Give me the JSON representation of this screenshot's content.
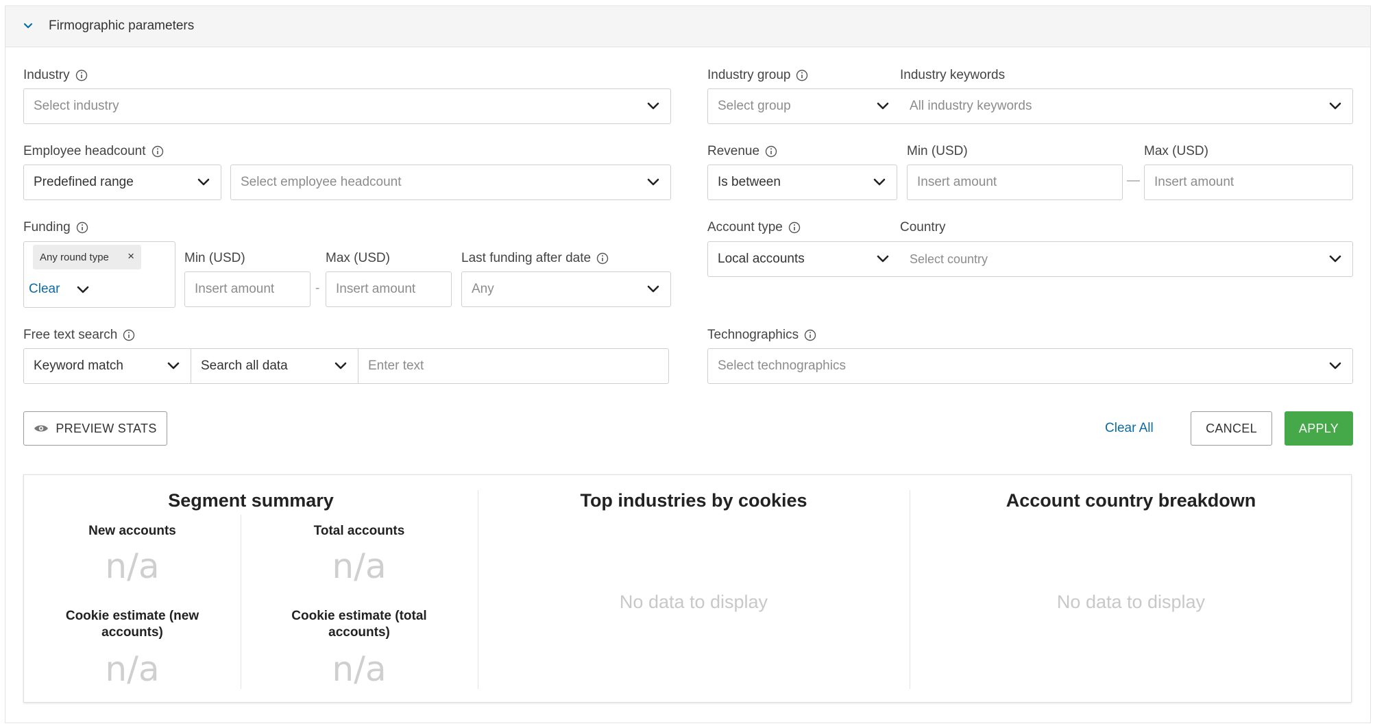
{
  "section": {
    "title": "Firmographic parameters"
  },
  "industry": {
    "label": "Industry",
    "placeholder": "Select industry"
  },
  "industry_group": {
    "label": "Industry group",
    "placeholder": "Select group"
  },
  "industry_keywords": {
    "label": "Industry keywords",
    "placeholder": "All industry keywords"
  },
  "employee_headcount": {
    "label": "Employee headcount",
    "mode_value": "Predefined range",
    "placeholder": "Select employee headcount"
  },
  "revenue": {
    "label": "Revenue",
    "operator_value": "Is between",
    "min_label": "Min (USD)",
    "max_label": "Max (USD)",
    "min_placeholder": "Insert amount",
    "max_placeholder": "Insert amount",
    "separator": "—"
  },
  "funding": {
    "label": "Funding",
    "chip": "Any round type",
    "chip_remove": "×",
    "clear_link": "Clear",
    "min_label": "Min (USD)",
    "max_label": "Max (USD)",
    "min_placeholder": "Insert amount",
    "max_placeholder": "Insert amount",
    "separator": "-",
    "last_funding_label": "Last funding after date",
    "last_funding_value": "Any"
  },
  "account_type": {
    "label": "Account type",
    "value": "Local accounts"
  },
  "country": {
    "label": "Country",
    "placeholder": "Select country"
  },
  "free_text": {
    "label": "Free text search",
    "match_value": "Keyword match",
    "scope_value": "Search all data",
    "placeholder": "Enter text"
  },
  "technographics": {
    "label": "Technographics",
    "placeholder": "Select technographics"
  },
  "actions": {
    "preview": "PREVIEW STATS",
    "clear_all": "Clear All",
    "cancel": "CANCEL",
    "apply": "APPLY"
  },
  "summary": {
    "title": "Segment summary",
    "new_accounts": "New accounts",
    "total_accounts": "Total accounts",
    "cookie_new_line1": "Cookie estimate (new",
    "cookie_new_line2": "accounts)",
    "cookie_total_line1": "Cookie estimate (total",
    "cookie_total_line2": "accounts)",
    "na": "n/a"
  },
  "top_industries": {
    "title": "Top industries by cookies",
    "empty": "No data to display"
  },
  "country_breakdown": {
    "title": "Account country breakdown",
    "empty": "No data to display"
  },
  "colors": {
    "accent_link": "#0a6ba6",
    "apply_green": "#45a849",
    "border": "#cfcfcf"
  }
}
